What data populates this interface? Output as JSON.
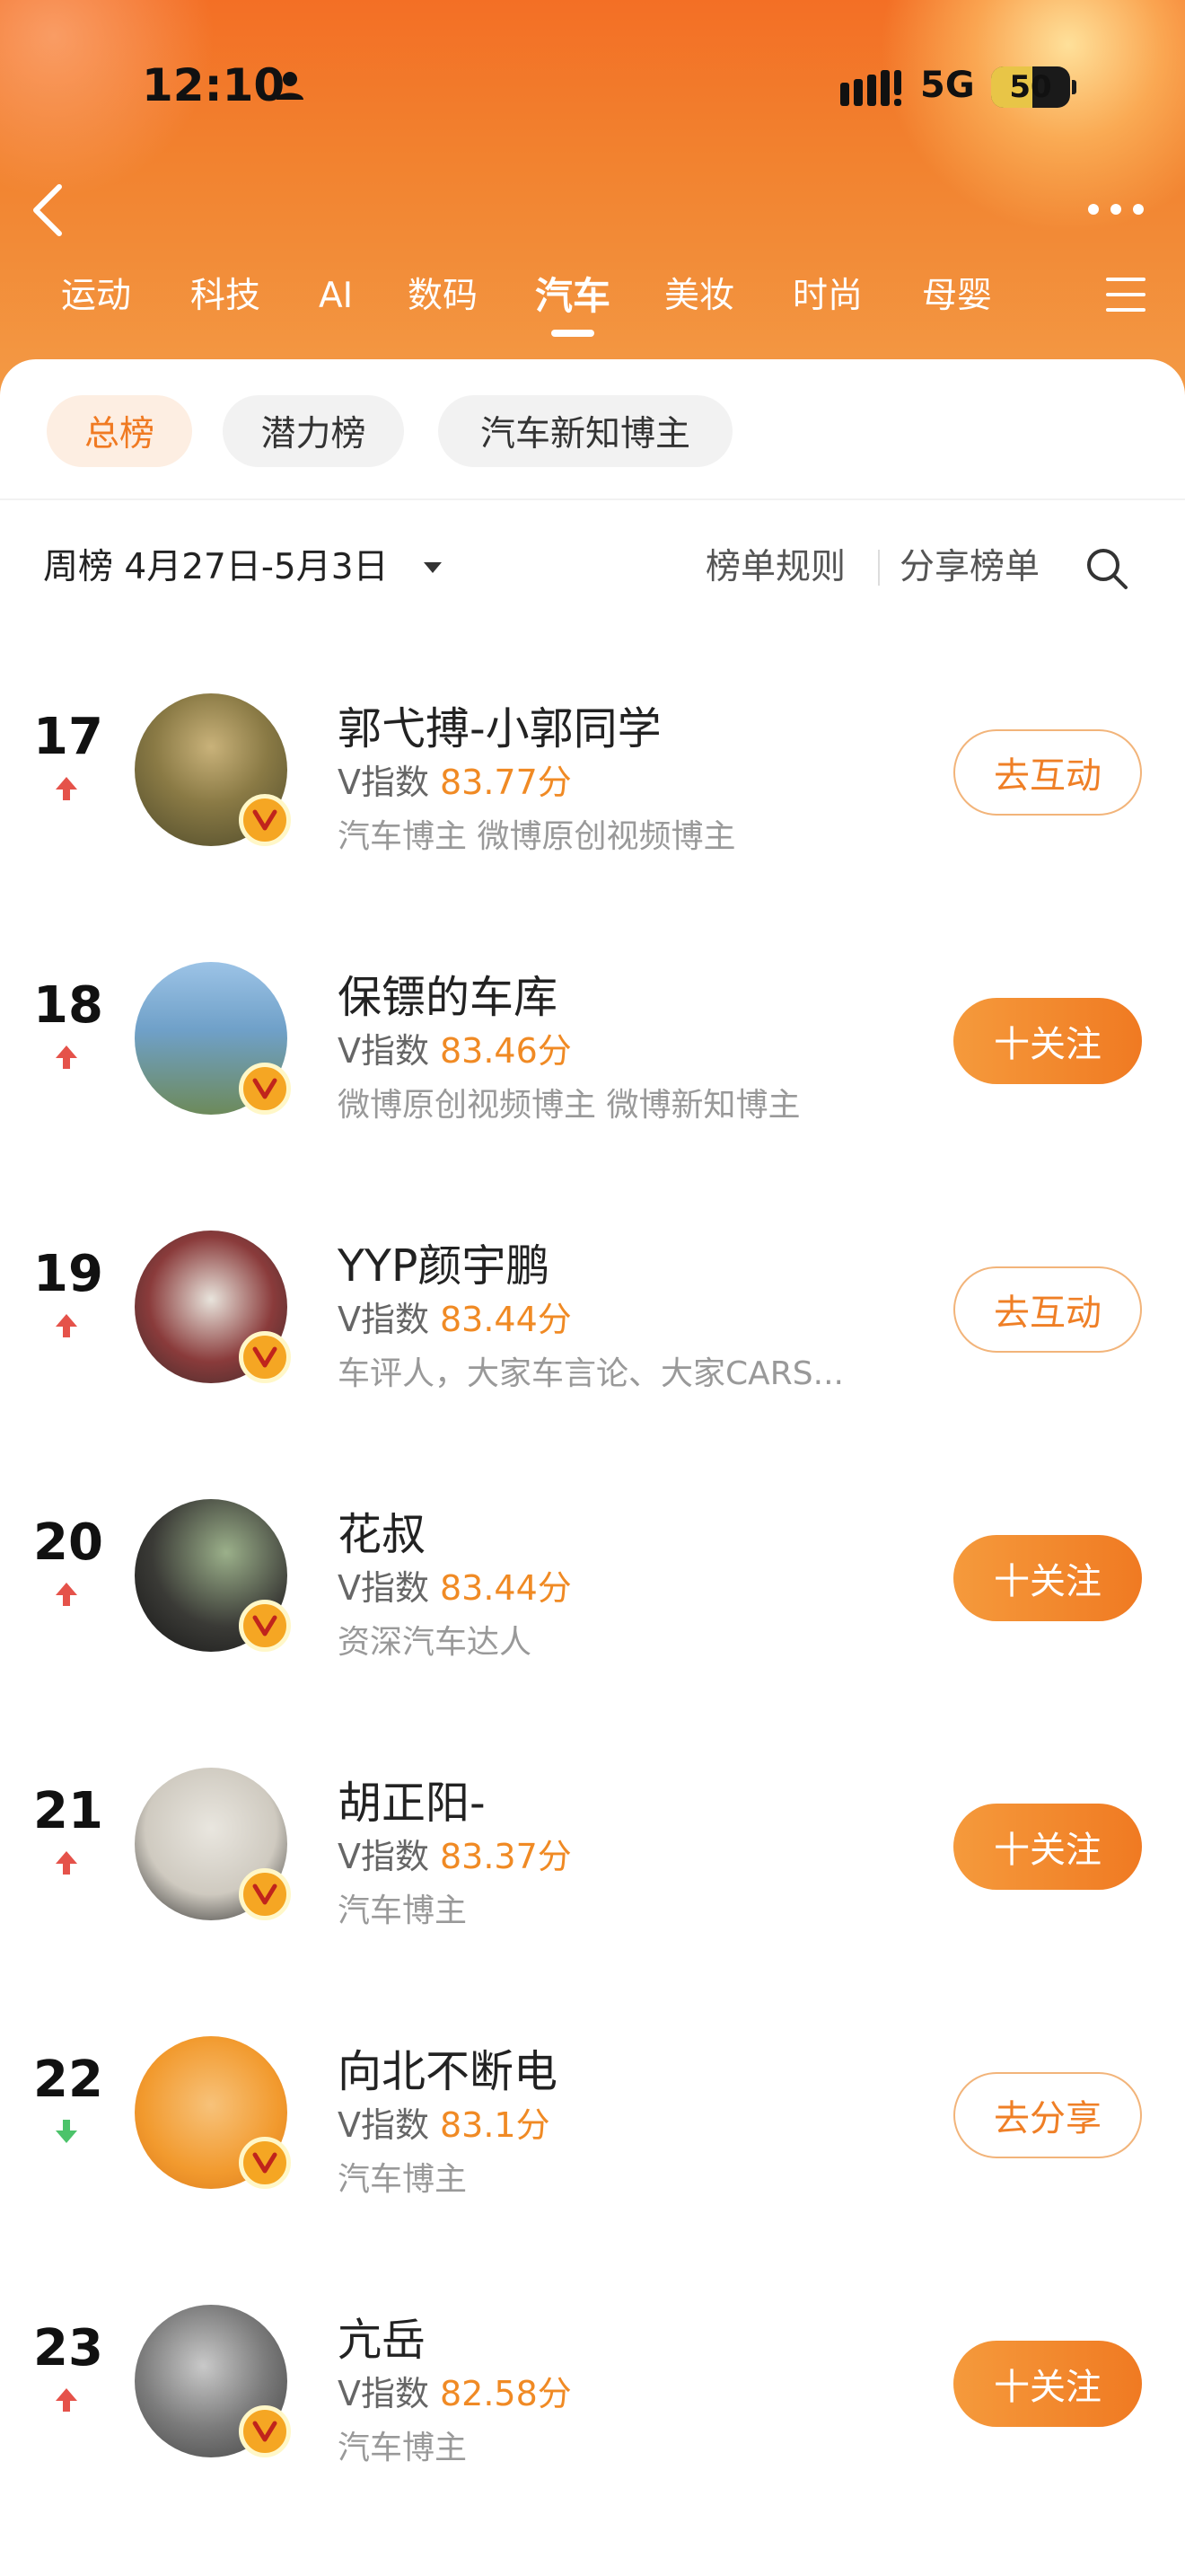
{
  "status": {
    "time": "12:10",
    "network": "5G",
    "battery": "50"
  },
  "category_tabs": [
    {
      "label": "运动"
    },
    {
      "label": "科技"
    },
    {
      "label": "AI"
    },
    {
      "label": "数码"
    },
    {
      "label": "汽车"
    },
    {
      "label": "美妆"
    },
    {
      "label": "时尚"
    },
    {
      "label": "母婴"
    }
  ],
  "active_category": "汽车",
  "sub_tabs": [
    {
      "label": "总榜"
    },
    {
      "label": "潜力榜"
    },
    {
      "label": "汽车新知博主"
    }
  ],
  "period": {
    "label": "周榜 4月27日-5月3日",
    "rules": "榜单规则",
    "share": "分享榜单"
  },
  "score_label": "V指数",
  "ranking": [
    {
      "rank": "17",
      "trend": "up",
      "name": "郭弋搏-小郭同学",
      "score": "83.77分",
      "tags": "汽车博主 微博原创视频博主",
      "action": "去互动",
      "action_style": "outline"
    },
    {
      "rank": "18",
      "trend": "up",
      "name": "保镖的车库",
      "score": "83.46分",
      "tags": "微博原创视频博主 微博新知博主",
      "action": "十关注",
      "action_style": "filled"
    },
    {
      "rank": "19",
      "trend": "up",
      "name": "YYP颜宇鹏",
      "score": "83.44分",
      "tags": "车评人，大家车言论、大家CARS...",
      "action": "去互动",
      "action_style": "outline"
    },
    {
      "rank": "20",
      "trend": "up",
      "name": "花叔",
      "score": "83.44分",
      "tags": "资深汽车达人",
      "action": "十关注",
      "action_style": "filled"
    },
    {
      "rank": "21",
      "trend": "up",
      "name": "胡正阳-",
      "score": "83.37分",
      "tags": "汽车博主",
      "action": "十关注",
      "action_style": "filled"
    },
    {
      "rank": "22",
      "trend": "down",
      "name": "向北不断电",
      "score": "83.1分",
      "tags": "汽车博主",
      "action": "去分享",
      "action_style": "outline"
    },
    {
      "rank": "23",
      "trend": "up",
      "name": "亢岳",
      "score": "82.58分",
      "tags": "汽车博主",
      "action": "十关注",
      "action_style": "filled"
    }
  ],
  "colors": {
    "accent": "#f07a22",
    "trend_up": "#e5524a",
    "trend_down": "#4cc36a"
  }
}
